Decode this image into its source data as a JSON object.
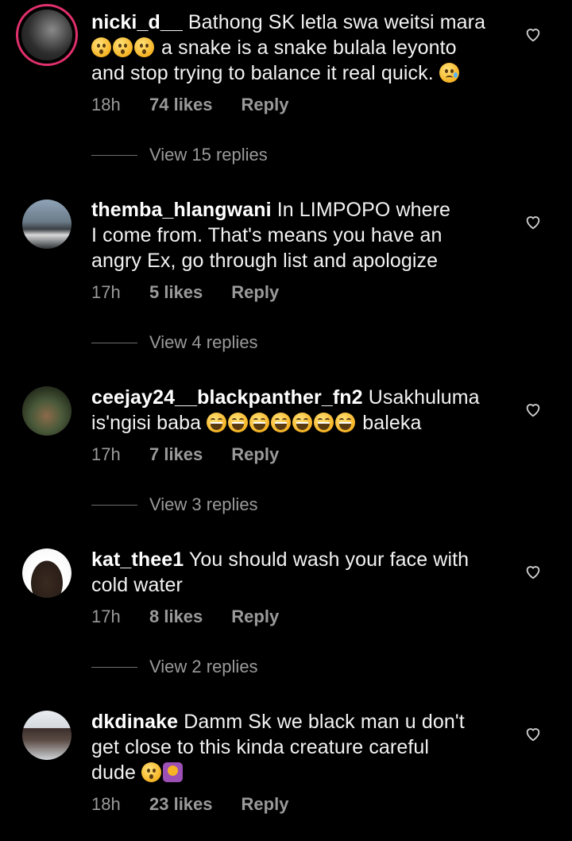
{
  "colors": {
    "background": "#000000",
    "text": "#f2f2f2",
    "meta": "#9a9a9a",
    "story_ring": "#e1306c"
  },
  "comments": [
    {
      "username": "nicki_d__",
      "text_1": "Bathong SK letla swa weitsi mara",
      "text_2": "a snake is a snake bulala leyonto",
      "text_3": "and stop trying to balance it real quick.",
      "time": "18h",
      "likes": "74 likes",
      "reply": "Reply",
      "view_replies": "View 15 replies",
      "has_story": true,
      "emojis": [
        "hushed-face",
        "hushed-face",
        "hushed-face",
        "crying-face"
      ]
    },
    {
      "username": "themba_hlangwani",
      "text_1": "In LIMPOPO where",
      "text_2": "I come from. That's means you have an",
      "text_3": "angry Ex, go through list and apologize",
      "time": "17h",
      "likes": "5 likes",
      "reply": "Reply",
      "view_replies": "View 4 replies"
    },
    {
      "username": "ceejay24__blackpanther_fn2",
      "text_1": "Usakhuluma",
      "text_2a": "is'ngisi baba",
      "text_2b": "baleka",
      "time": "17h",
      "likes": "7 likes",
      "reply": "Reply",
      "view_replies": "View 3 replies",
      "emojis": [
        "joy-face",
        "joy-face",
        "joy-face",
        "joy-face",
        "joy-face",
        "joy-face",
        "joy-face"
      ]
    },
    {
      "username": "kat_thee1",
      "text_1": "You should wash your face with",
      "text_2": "cold water",
      "time": "17h",
      "likes": "8 likes",
      "reply": "Reply",
      "view_replies": "View 2 replies"
    },
    {
      "username": "dkdinake",
      "text_1": "Damm Sk we black man u don't",
      "text_2": "get close to this kinda creature careful",
      "text_3": "dude",
      "time": "18h",
      "likes": "23 likes",
      "reply": "Reply",
      "emojis": [
        "hushed-face",
        "person-gesturing-no"
      ]
    }
  ]
}
